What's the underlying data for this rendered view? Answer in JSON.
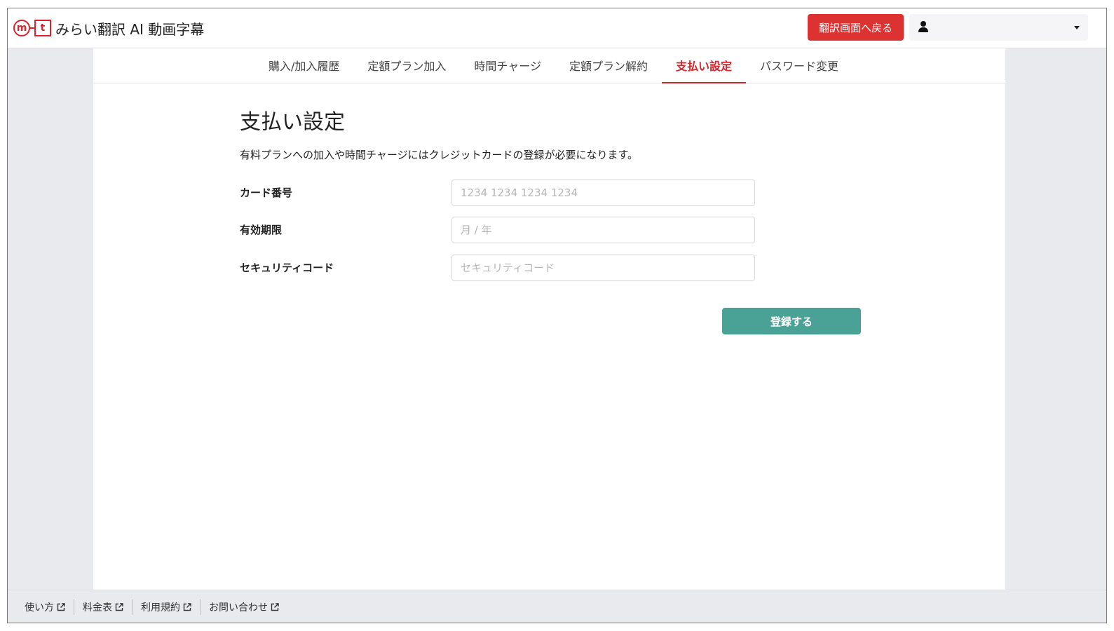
{
  "header": {
    "logo_m": "m",
    "logo_t": "t",
    "app_title": "みらい翻訳 AI 動画字幕",
    "back_button": "翻訳画面へ戻る",
    "user_icon": "user-icon",
    "user_name": ""
  },
  "tabs": [
    {
      "label": "購入/加入履歴",
      "active": false
    },
    {
      "label": "定額プラン加入",
      "active": false
    },
    {
      "label": "時間チャージ",
      "active": false
    },
    {
      "label": "定額プラン解約",
      "active": false
    },
    {
      "label": "支払い設定",
      "active": true
    },
    {
      "label": "パスワード変更",
      "active": false
    }
  ],
  "main": {
    "title": "支払い設定",
    "description": "有料プランへの加入や時間チャージにはクレジットカードの登録が必要になります。",
    "card_number": {
      "label": "カード番号",
      "placeholder": "1234 1234 1234 1234",
      "value": ""
    },
    "expiry": {
      "label": "有効期限",
      "placeholder": "月 / 年",
      "value": ""
    },
    "cvc": {
      "label": "セキュリティコード",
      "placeholder": "セキュリティコード",
      "value": ""
    },
    "register_button": "登録する"
  },
  "footer": {
    "links": [
      "使い方",
      "料金表",
      "利用規約",
      "お問い合わせ"
    ],
    "link_icon": "external-link-icon"
  },
  "colors": {
    "brand_red": "#d8232a",
    "button_red": "#dc3232",
    "register_teal": "#4aa297",
    "background_gray": "#e9eaee"
  }
}
